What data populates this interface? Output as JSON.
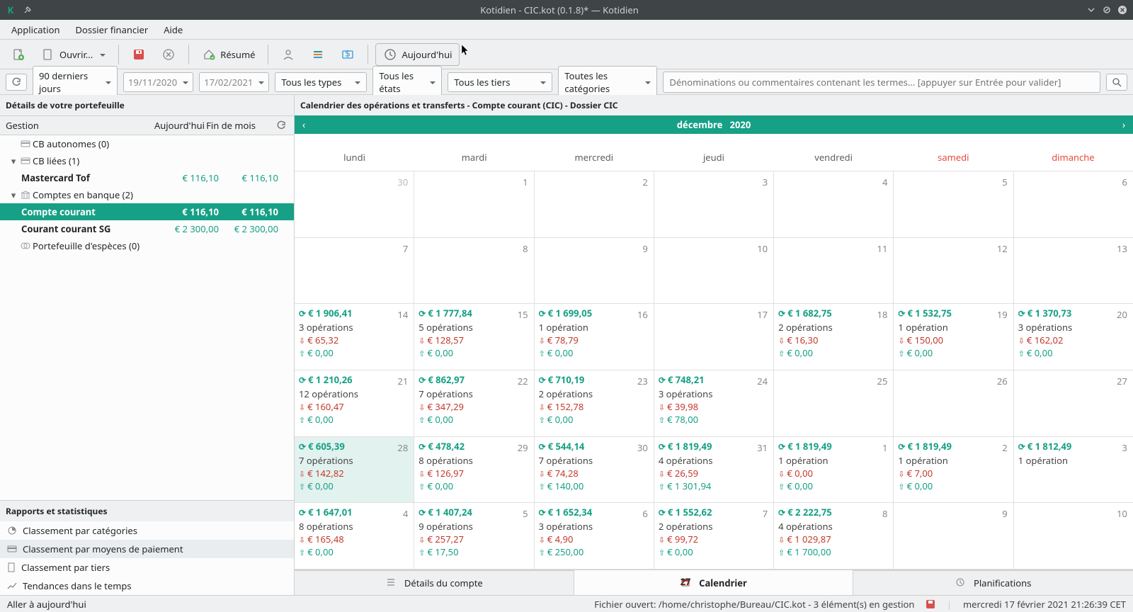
{
  "titlebar": {
    "title": "Kotidien - CIC.kot (0.1.8)* — Kotidien"
  },
  "menubar": {
    "items": [
      "Application",
      "Dossier financier",
      "Aide"
    ]
  },
  "toolbar": {
    "open_label": "Ouvrir...",
    "resume_label": "Résumé",
    "today_label": "Aujourd'hui"
  },
  "filterbar": {
    "period": "90 derniers jours",
    "date_from": "19/11/2020",
    "date_to": "17/02/2021",
    "types": "Tous les types",
    "states": "Tous les états",
    "tiers": "Tous les tiers",
    "categories": "Toutes les catégories",
    "search_placeholder": "Dénominations ou commentaires contenant les termes... [appuyer sur Entrée pour valider]"
  },
  "sidebar": {
    "portfolio_title": "Détails de votre portefeuille",
    "cols": {
      "gestion": "Gestion",
      "today": "Aujourd'hui",
      "eom": "Fin de mois"
    },
    "tree": {
      "cb_auto": "CB autonomes (0)",
      "cb_liees": "CB liées (1)",
      "mastercard": {
        "label": "Mastercard Tof",
        "today": "€ 116,10",
        "eom": "€ 116,10"
      },
      "bank": "Comptes en banque (2)",
      "cc": {
        "label": "Compte courant",
        "today": "€ 116,10",
        "eom": "€ 116,10"
      },
      "sg": {
        "label": "Courant courant SG",
        "today": "€ 2 300,00",
        "eom": "€ 2 300,00"
      },
      "cash": "Portefeuille d'espèces (0)"
    },
    "reports_title": "Rapports et statistiques",
    "reports": [
      "Classement par catégories",
      "Classement par moyens de paiement",
      "Classement par tiers",
      "Tendances dans le temps"
    ]
  },
  "calendar": {
    "title": "Calendrier des opérations et transferts - Compte courant (CIC) - Dossier CIC",
    "month_label": "décembre",
    "year_label": "2020",
    "days": [
      "lundi",
      "mardi",
      "mercredi",
      "jeudi",
      "vendredi",
      "samedi",
      "dimanche"
    ],
    "weeks": [
      [
        {
          "n": "30",
          "dim": true
        },
        {
          "n": "1"
        },
        {
          "n": "2"
        },
        {
          "n": "3"
        },
        {
          "n": "4"
        },
        {
          "n": "5"
        },
        {
          "n": "6"
        }
      ],
      [
        {
          "n": "7"
        },
        {
          "n": "8"
        },
        {
          "n": "9"
        },
        {
          "n": "10"
        },
        {
          "n": "11"
        },
        {
          "n": "12"
        },
        {
          "n": "13"
        }
      ],
      [
        {
          "n": "14",
          "bal": "€ 1 906,41",
          "ops": "3 opérations",
          "out": "€ 65,32",
          "in": "€ 0,00"
        },
        {
          "n": "15",
          "bal": "€ 1 777,84",
          "ops": "5 opérations",
          "out": "€ 128,57",
          "in": "€ 0,00"
        },
        {
          "n": "16",
          "bal": "€ 1 699,05",
          "ops": "1 opération",
          "out": "€ 78,79",
          "in": "€ 0,00"
        },
        {
          "n": "17"
        },
        {
          "n": "18",
          "bal": "€ 1 682,75",
          "ops": "2 opérations",
          "out": "€ 16,30",
          "in": "€ 0,00"
        },
        {
          "n": "19",
          "bal": "€ 1 532,75",
          "ops": "1 opération",
          "out": "€ 150,00",
          "in": "€ 0,00"
        },
        {
          "n": "20",
          "bal": "€ 1 370,73",
          "ops": "3 opérations",
          "out": "€ 162,02",
          "in": "€ 0,00"
        }
      ],
      [
        {
          "n": "21",
          "bal": "€ 1 210,26",
          "ops": "12 opérations",
          "out": "€ 160,47",
          "in": "€ 0,00"
        },
        {
          "n": "22",
          "bal": "€ 862,97",
          "ops": "7 opérations",
          "out": "€ 347,29",
          "in": "€ 0,00"
        },
        {
          "n": "23",
          "bal": "€ 710,19",
          "ops": "2 opérations",
          "out": "€ 152,78",
          "in": "€ 0,00"
        },
        {
          "n": "24",
          "bal": "€ 748,21",
          "ops": "3 opérations",
          "out": "€ 39,98",
          "in": "€ 78,00"
        },
        {
          "n": "25"
        },
        {
          "n": "26"
        },
        {
          "n": "27"
        }
      ],
      [
        {
          "n": "28",
          "bal": "€ 605,39",
          "ops": "7 opérations",
          "out": "€ 142,82",
          "in": "€ 0,00",
          "today": true
        },
        {
          "n": "29",
          "bal": "€ 478,42",
          "ops": "8 opérations",
          "out": "€ 126,97",
          "in": "€ 0,00"
        },
        {
          "n": "30",
          "bal": "€ 544,14",
          "ops": "7 opérations",
          "out": "€ 74,28",
          "in": "€ 140,00"
        },
        {
          "n": "31",
          "bal": "€ 1 819,49",
          "ops": "4 opérations",
          "out": "€ 26,59",
          "in": "€ 1 301,94"
        },
        {
          "n": "1",
          "bal": "€ 1 819,49",
          "ops": "1 opération",
          "out": "€ 0,00",
          "in": "€ 0,00"
        },
        {
          "n": "2",
          "bal": "€ 1 819,49",
          "ops": "1 opération",
          "out": "€ 7,00",
          "in": "€ 0,00"
        },
        {
          "n": "3",
          "bal": "€ 1 812,49",
          "ops": "1 opération"
        }
      ],
      [
        {
          "n": "4",
          "bal": "€ 1 647,01",
          "ops": "8 opérations",
          "out": "€ 165,48",
          "in": "€ 0,00"
        },
        {
          "n": "5",
          "bal": "€ 1 407,24",
          "ops": "9 opérations",
          "out": "€ 257,27",
          "in": "€ 17,50"
        },
        {
          "n": "6",
          "bal": "€ 1 652,34",
          "ops": "3 opérations",
          "out": "€ 4,90",
          "in": "€ 250,00"
        },
        {
          "n": "7",
          "bal": "€ 1 552,62",
          "ops": "2 opérations",
          "out": "€ 99,72",
          "in": "€ 0,00"
        },
        {
          "n": "8",
          "bal": "€ 2 222,75",
          "ops": "4 opérations",
          "out": "€ 1 029,87",
          "in": "€ 1 700,00"
        },
        {
          "n": "9"
        },
        {
          "n": "10"
        }
      ]
    ]
  },
  "bottom_tabs": {
    "details": "Détails du compte",
    "calendar": "Calendrier",
    "planif": "Planifications"
  },
  "statusbar": {
    "left": "Aller à aujourd'hui",
    "mid": "Fichier ouvert: /home/christophe/Bureau/CIC.kot - 3 élément(s) en gestion",
    "right": "mercredi 17 février 2021 21:26:39 CET"
  }
}
